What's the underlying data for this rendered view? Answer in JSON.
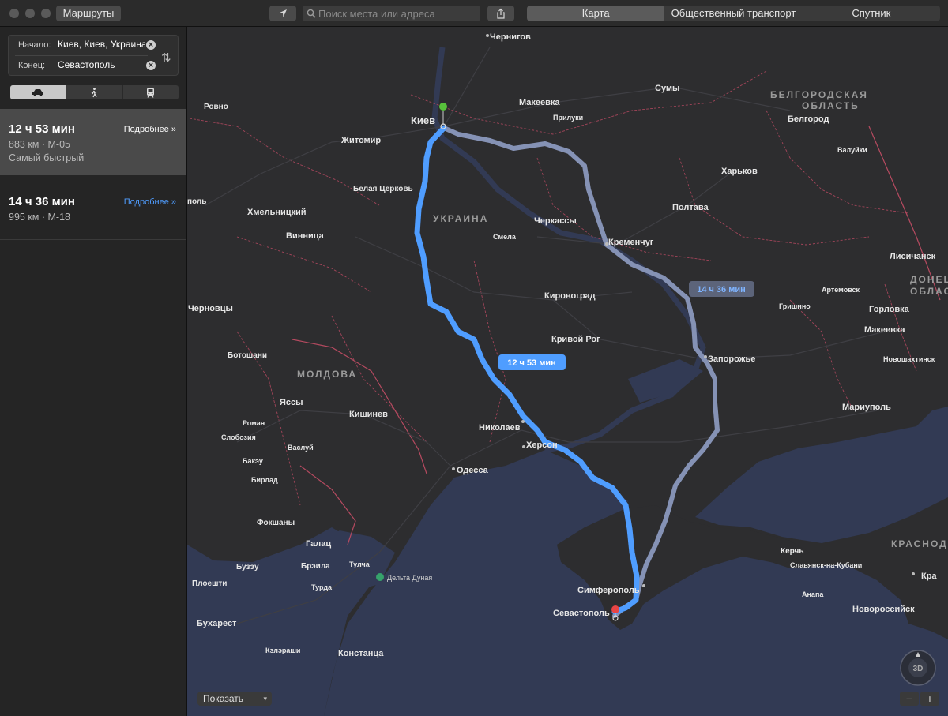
{
  "toolbar": {
    "routes_button": "Маршруты",
    "search_placeholder": "Поиск места или адреса",
    "tabs": [
      "Карта",
      "Общественный транспорт",
      "Спутник"
    ]
  },
  "sidebar": {
    "start_label": "Начало:",
    "start_value": "Киев, Киев, Украина",
    "end_label": "Конец:",
    "end_value": "Севастополь",
    "routes": [
      {
        "time": "12 ч 53 мин",
        "details": "883 км · M-05",
        "note": "Самый быстрый",
        "more": "Подробнее »"
      },
      {
        "time": "14 ч 36 мин",
        "details": "995 км · M-18",
        "more": "Подробнее »"
      }
    ]
  },
  "map": {
    "route_labels": {
      "primary": "12 ч 53 мин",
      "alternative": "14 ч 36 мин"
    },
    "poi": "Дельта Дуная",
    "cities": [
      "Чернигов",
      "Ровно",
      "Макеевка",
      "Прилуки",
      "Сумы",
      "Белгород",
      "Валуйки",
      "Киев",
      "Житомир",
      "Белая Церковь",
      "Харьков",
      "Полтава",
      "Черкассы",
      "Смела",
      "Кременчуг",
      "Хмельницкий",
      "Винница",
      "Лисичанск",
      "Артемовск",
      "Кировоград",
      "Черновцы",
      "Гришино",
      "Горловка",
      "Макеевка",
      "Кривой Рог",
      "Запорожье",
      "Новошахтинск",
      "Ботошани",
      "Мариуполь",
      "Яссы",
      "Кишинев",
      "Николаев",
      "Роман",
      "Слобозия",
      "Херсон",
      "Васлуй",
      "Бакэу",
      "Одесса",
      "Бирлад",
      "Фокшаны",
      "Галац",
      "Керчь",
      "Бузэу",
      "Брэила",
      "Тулча",
      "Славянск-на-Кубани",
      "Плоешти",
      "Турда",
      "Симферополь",
      "Анапа",
      "Севастополь",
      "Новороссийск",
      "Бухарест",
      "Кэлэраши",
      "Констанца",
      "Кра"
    ],
    "regions": [
      "УКРАИНА",
      "МОЛДОВА",
      "БЕЛГОРОДСКАЯ",
      "ОБЛАСТЬ",
      "ДОНЕЦКАЯ",
      "ОБЛАСТЬ",
      "КРАСНОД"
    ],
    "clipped_labels": [
      "поль"
    ],
    "show_button": "Показать",
    "compass_label": "3D",
    "zoom_out": "−",
    "zoom_in": "+"
  },
  "colors": {
    "primary_route": "#4f9dff",
    "alt_route": "#8592b5",
    "land": "#2d2d2f",
    "water": "#323a54",
    "border": "#a3455a"
  }
}
